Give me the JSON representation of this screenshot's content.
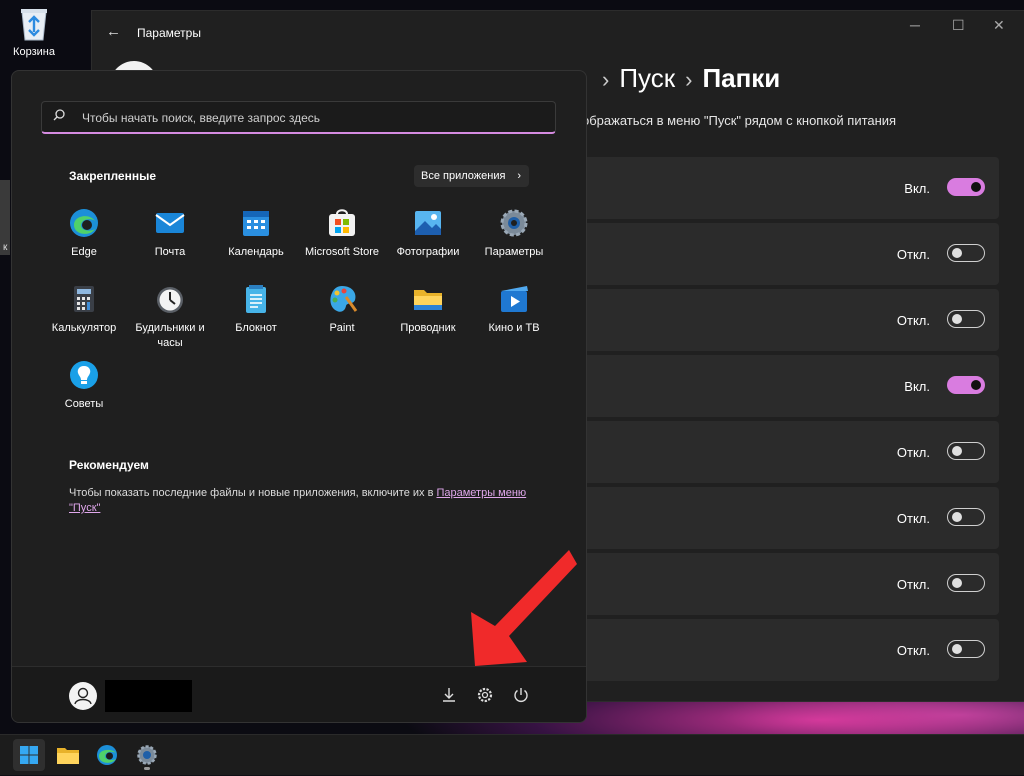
{
  "desktop": {
    "recycle_bin_label": "Корзина",
    "partial_icon_label": "к"
  },
  "settings": {
    "window_title": "Параметры",
    "back_glyph": "←",
    "controls": {
      "minimize": "─",
      "maximize": "☐",
      "close": "✕"
    },
    "breadcrumb": {
      "parent": "Пуск",
      "separator": "›",
      "current": "Папки"
    },
    "description": "ображаться в меню \"Пуск\" рядом с кнопкой питания",
    "rows": [
      {
        "state": "Вкл.",
        "on": true
      },
      {
        "state": "Откл.",
        "on": false
      },
      {
        "state": "Откл.",
        "on": false
      },
      {
        "state": "Вкл.",
        "on": true
      },
      {
        "state": "Откл.",
        "on": false
      },
      {
        "state": "Откл.",
        "on": false
      },
      {
        "state": "Откл.",
        "on": false
      },
      {
        "state": "Откл.",
        "on": false
      }
    ]
  },
  "start_menu": {
    "search_placeholder": "Чтобы начать поиск, введите запрос здесь",
    "pinned_title": "Закрепленные",
    "all_apps_label": "Все приложения",
    "all_apps_chevron": "›",
    "apps": [
      {
        "label": "Edge",
        "icon": "edge-icon"
      },
      {
        "label": "Почта",
        "icon": "mail-icon"
      },
      {
        "label": "Календарь",
        "icon": "calendar-icon"
      },
      {
        "label": "Microsoft Store",
        "icon": "store-icon"
      },
      {
        "label": "Фотографии",
        "icon": "photos-icon"
      },
      {
        "label": "Параметры",
        "icon": "settings-icon"
      },
      {
        "label": "Калькулятор",
        "icon": "calculator-icon"
      },
      {
        "label": "Будильники и часы",
        "icon": "alarm-clock-icon"
      },
      {
        "label": "Блокнот",
        "icon": "notepad-icon"
      },
      {
        "label": "Paint",
        "icon": "paint-icon"
      },
      {
        "label": "Проводник",
        "icon": "folder-icon"
      },
      {
        "label": "Кино и ТВ",
        "icon": "movies-icon"
      },
      {
        "label": "Советы",
        "icon": "tips-icon"
      }
    ],
    "recommended_title": "Рекомендуем",
    "recommended_text": "Чтобы показать последние файлы и новые приложения, включите их в ",
    "recommended_link": "Параметры меню \"Пуск\""
  },
  "taskbar": {
    "items": [
      "start-icon",
      "file-explorer-icon",
      "edge-icon",
      "settings-icon"
    ]
  },
  "colors": {
    "accent": "#d97ce0",
    "arrow": "#f02a2a"
  }
}
